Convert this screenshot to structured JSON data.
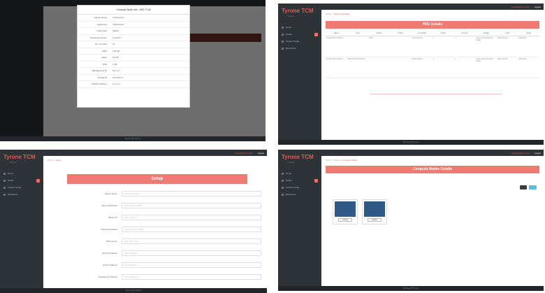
{
  "app": {
    "logo": "Tyrone TCM",
    "logo_sub": "Tyrone",
    "footer": "Tyrone @ Tyrone",
    "user": "tyrone@tyrone.com",
    "logout": "Logout",
    "nav": [
      "Home",
      "Nodes",
      "Cluster Config",
      "Resources"
    ]
  },
  "panel1": {
    "modal_title": "Compute Node Info - ESK-TCM",
    "rows": [
      {
        "k": "Cluster Name",
        "v": "TCM-Cluster"
      },
      {
        "k": "Hostname",
        "v": "TCM-Node1"
      },
      {
        "k": "Node Type",
        "v": "Master"
      },
      {
        "k": "Operating System",
        "v": "CentOS 7"
      },
      {
        "k": "No. of Cores",
        "v": "64"
      },
      {
        "k": "RAM",
        "v": "128 GB"
      },
      {
        "k": "Swap",
        "v": "16 GB"
      },
      {
        "k": "Disk",
        "v": "2 TB"
      },
      {
        "k": "Management IP",
        "v": "10.1.1.1"
      },
      {
        "k": "Private IP",
        "v": "192.168.1.1"
      },
      {
        "k": "IPMI IP Address",
        "v": "10.2.1.1"
      }
    ]
  },
  "panel2": {
    "crumbs": [
      "Home",
      "Node Info Details"
    ],
    "banner": "PDU Details",
    "headers": [
      "Name",
      "Type",
      "Status",
      "Power",
      "Connected",
      "Outlet",
      "Current",
      "Voltage",
      "Load",
      "Action"
    ],
    "rows": [
      [
        "Cluster-PDU-01 Node-1",
        "",
        "Active",
        "",
        "Node-1 Node-2",
        "1",
        "1",
        "Active monitoring Outlet Details",
        "Status Normal",
        "Edit Delete"
      ],
      [
        "Cluster-PDU-02 Node-2",
        "Metered PDU Monitored",
        "",
        "",
        "Node-3 Node-4",
        "2",
        "1",
        "Active monitoring Outlet Details",
        "Status Normal",
        "Edit Delete"
      ]
    ]
  },
  "panel3": {
    "crumbs": [
      "Home",
      "Setup"
    ],
    "banner": "Setup",
    "fields": [
      {
        "label": "Cluster Name",
        "placeholder": "Enter cluster name"
      },
      {
        "label": "Admin Password",
        "placeholder": "Enter admin password"
      },
      {
        "label": "Master IP",
        "placeholder": "Enter master IP"
      },
      {
        "label": "Network Interface",
        "placeholder": "Select network interface"
      },
      {
        "label": "DNS Server",
        "placeholder": "Enter DNS server"
      },
      {
        "label": "Start IP Address",
        "placeholder": "Start IP address"
      },
      {
        "label": "End IP Address",
        "placeholder": "End IP address"
      },
      {
        "label": "Gateway IP Address",
        "placeholder": "Enter gateway IP"
      }
    ]
  },
  "panel4": {
    "crumbs": [
      "Home",
      "Nodes",
      "Compute Nodes"
    ],
    "banner": "Compute Nodes Details",
    "cards": [
      {
        "label": "Node1"
      },
      {
        "label": "Node2"
      }
    ]
  },
  "colors": {
    "accent": "#ef7b72",
    "sidebar": "#2e3338",
    "button_dark": "#3a3f44",
    "button_blue": "#5bc0de"
  }
}
